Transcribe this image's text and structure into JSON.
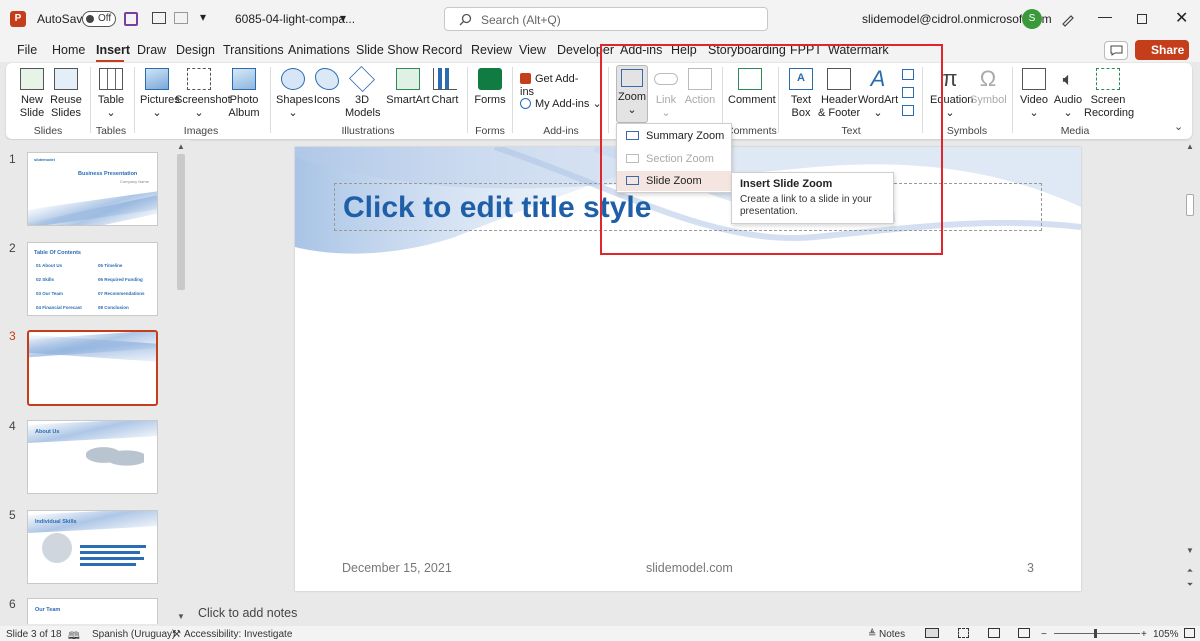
{
  "titlebar": {
    "autosave_label": "AutoSave",
    "autosave_state": "Off",
    "filename": "6085-04-light-compa...",
    "search_placeholder": "Search (Alt+Q)",
    "account": "slidemodel@cidrol.onmicrosoft.com",
    "avatar_initial": "S"
  },
  "menu": {
    "tabs": [
      "File",
      "Home",
      "Insert",
      "Draw",
      "Design",
      "Transitions",
      "Animations",
      "Slide Show",
      "Record",
      "Review",
      "View",
      "Developer",
      "Add-ins",
      "Help",
      "Storyboarding",
      "FPPT",
      "Watermark"
    ],
    "active": "Insert",
    "share": "Share"
  },
  "ribbon": {
    "buttons": {
      "new_slide": "New\nSlide",
      "reuse_slides": "Reuse\nSlides",
      "table": "Table",
      "pictures": "Pictures",
      "screenshot": "Screenshot",
      "photo_album": "Photo\nAlbum",
      "shapes": "Shapes",
      "icons": "Icons",
      "models_3d": "3D\nModels",
      "smartart": "SmartArt",
      "chart": "Chart",
      "forms": "Forms",
      "get_addins": "Get Add-ins",
      "my_addins": "My Add-ins",
      "zoom": "Zoom",
      "link": "Link",
      "action": "Action",
      "comment": "Comment",
      "text_box": "Text\nBox",
      "header_footer": "Header\n& Footer",
      "wordart": "WordArt",
      "equation": "Equation",
      "symbol": "Symbol",
      "video": "Video",
      "audio": "Audio",
      "screen_recording": "Screen\nRecording"
    },
    "groups": [
      "Slides",
      "Tables",
      "Images",
      "Illustrations",
      "Forms",
      "Add-ins",
      "Comments",
      "Text",
      "Symbols",
      "Media"
    ]
  },
  "zoom_menu": {
    "items": [
      "Summary Zoom",
      "Section Zoom",
      "Slide Zoom"
    ],
    "tooltip_title": "Insert Slide Zoom",
    "tooltip_body": "Create a link to a slide in your presentation."
  },
  "thumbnails": {
    "numbers": [
      "1",
      "2",
      "3",
      "4",
      "5",
      "6"
    ],
    "s1_title": "Business Presentation",
    "s1_sub": "Company Name",
    "s2_title": "Table Of Contents",
    "s2_items": [
      "01 About Us",
      "02 Skills",
      "03 Our Team",
      "04 Financial Forecast",
      "05 Timeline",
      "06 Required Funding",
      "07 Recommendations",
      "08 Conclusion"
    ],
    "s4_title": "About Us",
    "s5_title": "Individual Skills",
    "s6_title": "Our Team"
  },
  "slide": {
    "title": "Click to edit title style",
    "date": "December 15, 2021",
    "site": "slidemodel.com",
    "page": "3"
  },
  "notes_placeholder": "Click to add notes",
  "status": {
    "slide_info": "Slide 3 of 18",
    "language": "Spanish (Uruguay)",
    "accessibility": "Accessibility: Investigate",
    "notes": "Notes",
    "zoom": "105%"
  },
  "colors": {
    "accent": "#c43e1c",
    "highlight_box": "#e0262c",
    "title_blue": "#1f5fa8"
  }
}
